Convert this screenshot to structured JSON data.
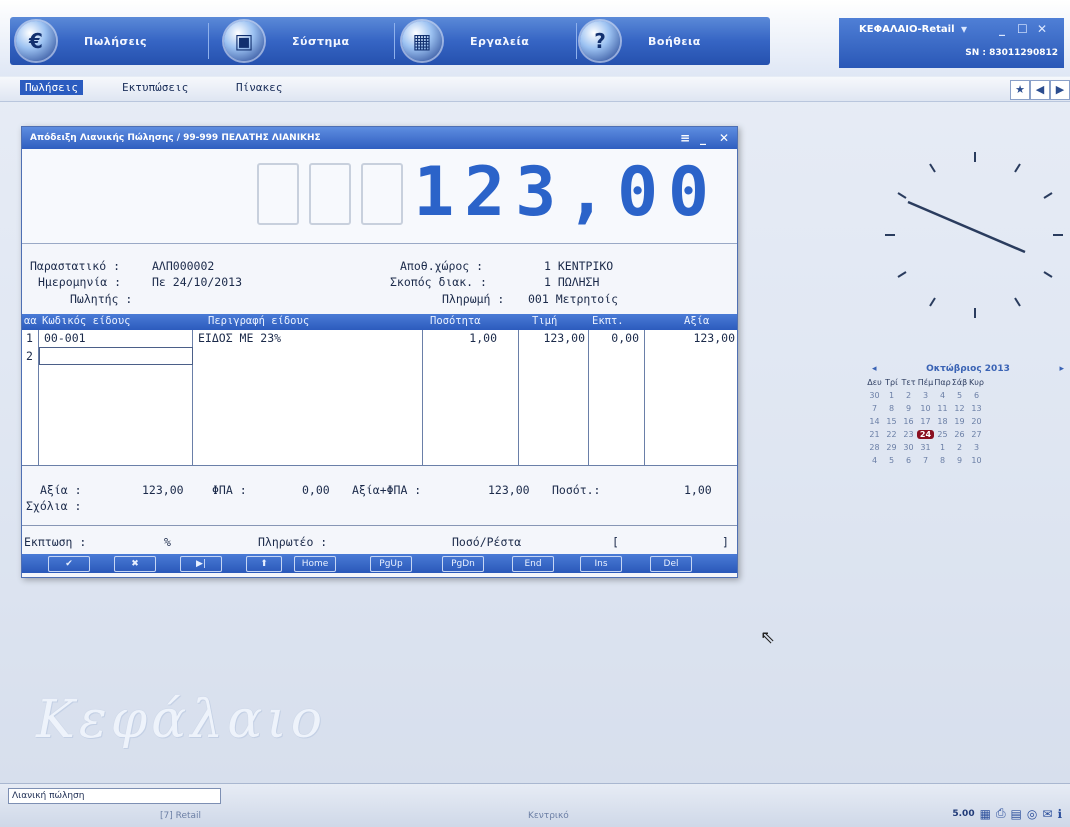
{
  "topmenu": [
    {
      "label": "Πωλήσεις",
      "icon": "sales-icon"
    },
    {
      "label": "Σύστημα",
      "icon": "system-icon"
    },
    {
      "label": "Εργαλεία",
      "icon": "tools-icon"
    },
    {
      "label": "Βοήθεια",
      "icon": "help-icon"
    }
  ],
  "app": {
    "title": "ΚΕΦΑΛΑΙΟ-Retail",
    "serial": "SN : 83011290812"
  },
  "subnav": [
    "Πωλήσεις",
    "Εκτυπώσεις",
    "Πίνακες"
  ],
  "dialog": {
    "title": "Απόδειξη Λιανικής Πώλησης / 99-999 ΠΕΛΑΤΗΣ ΛΙΑΝΙΚΗΣ",
    "display_value": "123,00",
    "fields": {
      "parastatiko_label": "Παραστατικό :",
      "parastatiko": "ΑΛΠ000002",
      "date_label": "Ημερομηνία : ",
      "date": "Πε 24/10/2013",
      "seller_label": "Πωλητής :",
      "seller": "",
      "store_label": "Αποθ.χώρος :",
      "store": "1 ΚΕΝΤΡΙΚΟ",
      "purpose_label": "Σκοπός διακ. :",
      "purpose": "1 ΠΩΛΗΣΗ",
      "payment_label": "Πληρωμή :",
      "payment": "001 Μετρητοίς"
    },
    "columns": [
      "αα",
      "Κωδικός είδους",
      "Περιγραφή είδους",
      "Ποσότητα",
      "Τιμή",
      "Εκπτ.",
      "Αξία"
    ],
    "rows": [
      {
        "aa": "1",
        "code": "00-001",
        "desc": "ΕΙΔΟΣ ΜΕ 23%",
        "qty": "1,00",
        "price": "123,00",
        "disc": "0,00",
        "value": "123,00"
      },
      {
        "aa": "2",
        "code": "",
        "desc": "",
        "qty": "",
        "price": "",
        "disc": "",
        "value": ""
      }
    ],
    "totals": {
      "value_label": "Αξία :",
      "value": "123,00",
      "vat_label": "ΦΠΑ :",
      "vat": "0,00",
      "value_vat_label": "Αξία+ΦΠΑ :",
      "value_vat": "123,00",
      "qty_label": "Ποσότ.:",
      "qty": "1,00",
      "comments_label": "Σχόλια :"
    },
    "payment_row": {
      "discount_label": "Εκπτωση :",
      "percent": "%",
      "to_pay_label": "Πληρωτέο :",
      "change_label": "Ποσό/Ρέστα",
      "bracket_open": "[",
      "bracket_close": "]"
    },
    "commands": [
      "✔",
      "✖",
      "▶|",
      "⬆",
      "Home",
      "PgUp",
      "PgDn",
      "End",
      "Ins",
      "Del"
    ]
  },
  "calendar": {
    "month": "Οκτώβριος 2013",
    "weekdays": [
      "Δευ",
      "Τρί",
      "Τετ",
      "Πέμ",
      "Παρ",
      "Σάβ",
      "Κυρ"
    ],
    "weeks": [
      [
        "30",
        "1",
        "2",
        "3",
        "4",
        "5",
        "6"
      ],
      [
        "7",
        "8",
        "9",
        "10",
        "11",
        "12",
        "13"
      ],
      [
        "14",
        "15",
        "16",
        "17",
        "18",
        "19",
        "20"
      ],
      [
        "21",
        "22",
        "23",
        "24",
        "25",
        "26",
        "27"
      ],
      [
        "28",
        "29",
        "30",
        "31",
        "1",
        "2",
        "3"
      ],
      [
        "4",
        "5",
        "6",
        "7",
        "8",
        "9",
        "10"
      ]
    ],
    "today": "24"
  },
  "watermark": "Κεφάλαιο",
  "status": {
    "left": "Λιανική πώληση",
    "module": "[7] Retail",
    "location": "Κεντρικό",
    "version": "5.00",
    "tray_icons": [
      "grid-icon",
      "print-icon",
      "calc-icon",
      "disc-icon",
      "mail-icon",
      "info-icon"
    ]
  },
  "colors": {
    "accent": "#2f5ec0",
    "display_digits": "#2b63c9",
    "today": "#8a1020"
  }
}
